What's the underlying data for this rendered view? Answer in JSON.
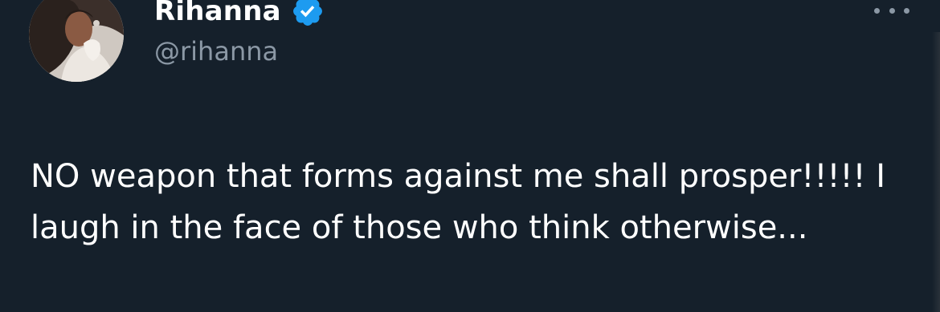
{
  "user": {
    "display_name": "Rihanna",
    "handle": "@rihanna",
    "verified": true,
    "avatar_icon": "profile-photo"
  },
  "tweet": {
    "text": "NO weapon that forms against me shall prosper!!!!! I laugh in the face of those who think otherwise..."
  },
  "actions": {
    "more_icon": "more-dots-icon"
  },
  "colors": {
    "background": "#15202b",
    "text": "#ffffff",
    "secondary_text": "#8b98a5",
    "verified_badge": "#1d9bf0"
  }
}
